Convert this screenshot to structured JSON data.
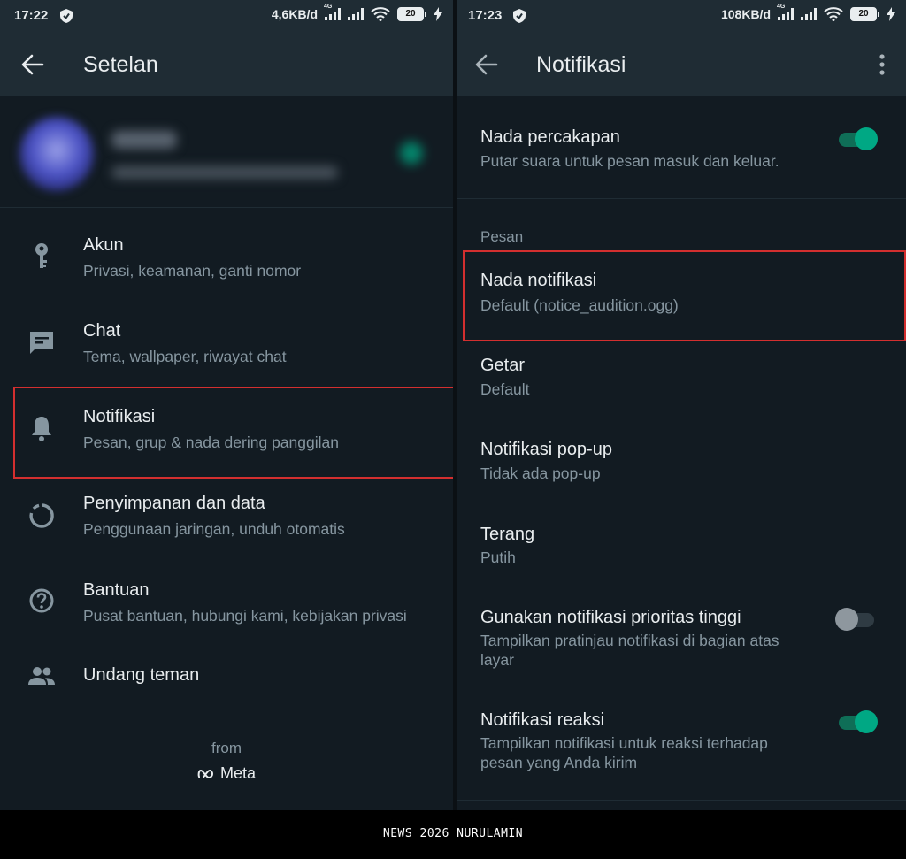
{
  "left": {
    "status": {
      "time": "17:22",
      "speed": "4,6KB/d",
      "network": "4G",
      "battery": "20"
    },
    "appbar": {
      "title": "Setelan"
    },
    "items": [
      {
        "title": "Akun",
        "subtitle": "Privasi, keamanan, ganti nomor",
        "icon": "key-icon"
      },
      {
        "title": "Chat",
        "subtitle": "Tema, wallpaper, riwayat chat",
        "icon": "chat-icon"
      },
      {
        "title": "Notifikasi",
        "subtitle": "Pesan, grup & nada dering panggilan",
        "icon": "bell-icon"
      },
      {
        "title": "Penyimpanan dan data",
        "subtitle": "Penggunaan jaringan, unduh otomatis",
        "icon": "storage-circle-icon"
      },
      {
        "title": "Bantuan",
        "subtitle": "Pusat bantuan, hubungi kami, kebijakan privasi",
        "icon": "help-icon"
      },
      {
        "title": "Undang teman",
        "subtitle": "",
        "icon": "people-icon"
      }
    ],
    "from": "from",
    "brand": "Meta"
  },
  "right": {
    "status": {
      "time": "17:23",
      "speed": "108KB/d",
      "network": "4G",
      "battery": "20"
    },
    "appbar": {
      "title": "Notifikasi"
    },
    "conversation": {
      "title": "Nada percakapan",
      "subtitle": "Putar suara untuk pesan masuk dan keluar.",
      "toggle": true
    },
    "section_label": "Pesan",
    "rows": [
      {
        "title": "Nada notifikasi",
        "subtitle": "Default (notice_audition.ogg)"
      },
      {
        "title": "Getar",
        "subtitle": "Default"
      },
      {
        "title": "Notifikasi pop-up",
        "subtitle": "Tidak ada pop-up"
      },
      {
        "title": "Terang",
        "subtitle": "Putih"
      },
      {
        "title": "Gunakan notifikasi prioritas tinggi",
        "subtitle": "Tampilkan pratinjau notifikasi di bagian atas layar",
        "toggle": false
      },
      {
        "title": "Notifikasi reaksi",
        "subtitle": "Tampilkan notifikasi untuk reaksi terhadap pesan yang Anda kirim",
        "toggle": true
      }
    ]
  },
  "colors": {
    "background": "#121b22",
    "appbar": "#1f2c34",
    "accent": "#00a884",
    "highlight": "#d32f2f"
  },
  "footer": {
    "caption": "NEWS 2026 NURULAMIN"
  }
}
